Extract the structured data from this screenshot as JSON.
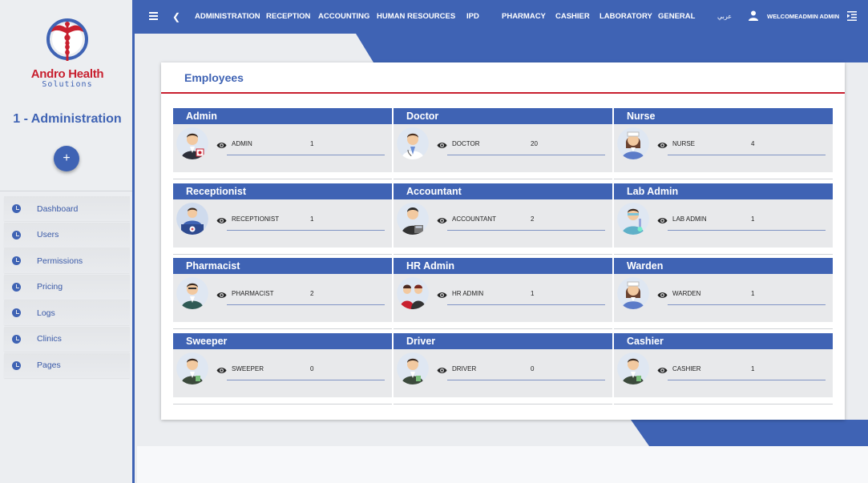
{
  "brand": {
    "name": "Andro Health",
    "tagline": "Solutions"
  },
  "clinic": "1 - Administration",
  "add_button": "+",
  "sidebar": {
    "items": [
      {
        "label": "Dashboard",
        "icon": "clock-icon"
      },
      {
        "label": "Users",
        "icon": "clock-icon"
      },
      {
        "label": "Permissions",
        "icon": "clock-icon"
      },
      {
        "label": "Pricing",
        "icon": "clock-icon"
      },
      {
        "label": "Logs",
        "icon": "clock-icon"
      },
      {
        "label": "Clinics",
        "icon": "clock-icon"
      },
      {
        "label": "Pages",
        "icon": "clock-icon"
      }
    ]
  },
  "topbar": {
    "nav": [
      "ADMINISTRATION",
      "RECEPTION",
      "ACCOUNTING",
      "HUMAN RESOURCES",
      "IPD",
      "PHARMACY",
      "CASHIER",
      "LABORATORY",
      "GENERAL"
    ],
    "language": "عربي",
    "welcome": "WELCOMEADMIN ADMIN"
  },
  "page": {
    "title": "Employees"
  },
  "employees": [
    {
      "title": "Admin",
      "role": "ADMIN",
      "count": "1",
      "avatar": "admin"
    },
    {
      "title": "Doctor",
      "role": "DOCTOR",
      "count": "20",
      "avatar": "doctor"
    },
    {
      "title": "Nurse",
      "role": "NURSE",
      "count": "4",
      "avatar": "nurse"
    },
    {
      "title": "Receptionist",
      "role": "RECEPTIONIST",
      "count": "1",
      "avatar": "receptionist"
    },
    {
      "title": "Accountant",
      "role": "ACCOUNTANT",
      "count": "2",
      "avatar": "accountant"
    },
    {
      "title": "Lab Admin",
      "role": "LAB ADMIN",
      "count": "1",
      "avatar": "labadmin"
    },
    {
      "title": "Pharmacist",
      "role": "PHARMACIST",
      "count": "2",
      "avatar": "pharmacist"
    },
    {
      "title": "HR Admin",
      "role": "HR ADMIN",
      "count": "1",
      "avatar": "hradmin"
    },
    {
      "title": "Warden",
      "role": "WARDEN",
      "count": "1",
      "avatar": "warden"
    },
    {
      "title": "Sweeper",
      "role": "SWEEPER",
      "count": "0",
      "avatar": "sweeper"
    },
    {
      "title": "Driver",
      "role": "DRIVER",
      "count": "0",
      "avatar": "driver"
    },
    {
      "title": "Cashier",
      "role": "CASHIER",
      "count": "1",
      "avatar": "cashier"
    }
  ],
  "colors": {
    "primary": "#3f63b4",
    "accent": "#c8202f",
    "sidebar_bg": "#eceef1"
  }
}
